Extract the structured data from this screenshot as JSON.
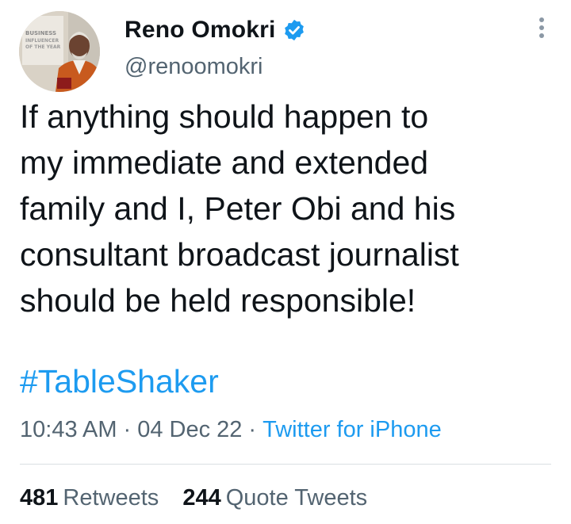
{
  "author": {
    "display_name": "Reno Omokri",
    "handle": "@renoomokri",
    "verified": true,
    "avatar_text": [
      "BUSINESS",
      "INFLUENCER",
      "OF THE YEAR"
    ]
  },
  "tweet": {
    "text": "If anything should happen to\nmy immediate and extended\nfamily and I, Peter Obi and his\nconsultant broadcast journalist\nshould be held responsible!",
    "hashtag": "#TableShaker",
    "time": "10:43 AM",
    "separator": "·",
    "date": "04 Dec 22",
    "source": "Twitter for iPhone"
  },
  "stats": {
    "retweets_count": "481",
    "retweets_label": "Retweets",
    "quotes_count": "244",
    "quotes_label": "Quote Tweets"
  },
  "icons": {
    "verified": "verified-badge-icon",
    "more": "more-options-icon"
  },
  "colors": {
    "link": "#1d9bf0",
    "secondary_text": "#536471",
    "primary_text": "#0f1419",
    "divider": "#dadfe3"
  }
}
